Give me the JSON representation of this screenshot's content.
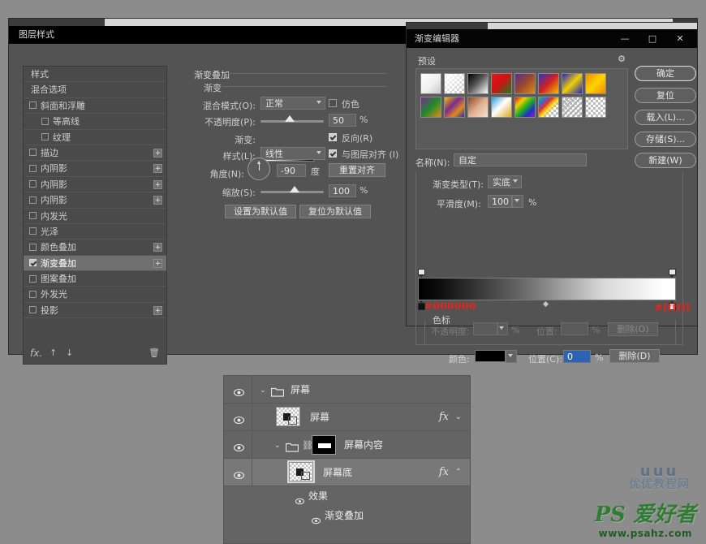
{
  "layer_style_dialog": {
    "title": "图层样式",
    "styles_list": {
      "items": [
        {
          "label": "样式",
          "type": "plain",
          "checkbox": false,
          "checked": false,
          "plus": false,
          "indent": false,
          "selected": false
        },
        {
          "label": "混合选项",
          "type": "plain",
          "checkbox": false,
          "checked": false,
          "plus": false,
          "indent": false,
          "selected": false
        },
        {
          "label": "斜面和浮雕",
          "type": "check",
          "checkbox": true,
          "checked": false,
          "plus": false,
          "indent": false,
          "selected": false
        },
        {
          "label": "等高线",
          "type": "check",
          "checkbox": true,
          "checked": false,
          "plus": false,
          "indent": true,
          "selected": false
        },
        {
          "label": "纹理",
          "type": "check",
          "checkbox": true,
          "checked": false,
          "plus": false,
          "indent": true,
          "selected": false
        },
        {
          "label": "描边",
          "type": "check",
          "checkbox": true,
          "checked": false,
          "plus": true,
          "indent": false,
          "selected": false
        },
        {
          "label": "内阴影",
          "type": "check",
          "checkbox": true,
          "checked": false,
          "plus": true,
          "indent": false,
          "selected": false
        },
        {
          "label": "内阴影",
          "type": "check",
          "checkbox": true,
          "checked": false,
          "plus": true,
          "indent": false,
          "selected": false
        },
        {
          "label": "内阴影",
          "type": "check",
          "checkbox": true,
          "checked": false,
          "plus": true,
          "indent": false,
          "selected": false
        },
        {
          "label": "内发光",
          "type": "check",
          "checkbox": true,
          "checked": false,
          "plus": false,
          "indent": false,
          "selected": false
        },
        {
          "label": "光泽",
          "type": "check",
          "checkbox": true,
          "checked": false,
          "plus": false,
          "indent": false,
          "selected": false
        },
        {
          "label": "颜色叠加",
          "type": "check",
          "checkbox": true,
          "checked": false,
          "plus": true,
          "indent": false,
          "selected": false
        },
        {
          "label": "渐变叠加",
          "type": "check",
          "checkbox": true,
          "checked": true,
          "plus": true,
          "indent": false,
          "selected": true
        },
        {
          "label": "图案叠加",
          "type": "check",
          "checkbox": true,
          "checked": false,
          "plus": false,
          "indent": false,
          "selected": false
        },
        {
          "label": "外发光",
          "type": "check",
          "checkbox": true,
          "checked": false,
          "plus": false,
          "indent": false,
          "selected": false
        },
        {
          "label": "投影",
          "type": "check",
          "checkbox": true,
          "checked": false,
          "plus": true,
          "indent": false,
          "selected": false
        }
      ],
      "footer": {
        "fx": "fx.",
        "move_up": "↑",
        "move_down": "↓",
        "delete": "🗑"
      }
    },
    "gradient_overlay": {
      "section_title": "渐变叠加",
      "sub_title": "渐变",
      "blend_mode_label": "混合模式(O):",
      "blend_mode_value": "正常",
      "dither_label": "仿色",
      "dither_checked": false,
      "opacity_label": "不透明度(P):",
      "opacity_value": "50",
      "opacity_unit": "%",
      "gradient_label": "渐变:",
      "reverse_label": "反向(R)",
      "reverse_checked": true,
      "style_label": "样式(L):",
      "style_value": "线性",
      "align_label": "与图层对齐 (I)",
      "align_checked": true,
      "angle_label": "角度(N):",
      "angle_value": "-90",
      "angle_unit": "度",
      "reset_align_button": "重置对齐",
      "scale_label": "缩放(S):",
      "scale_value": "100",
      "scale_unit": "%",
      "set_default_button": "设置为默认值",
      "reset_default_button": "复位为默认值"
    }
  },
  "gradient_editor_dialog": {
    "title": "渐变编辑器",
    "window_controls": {
      "minimize": "—",
      "maximize": "□",
      "close": "✕"
    },
    "presets_label": "预设",
    "gear_icon": "⚙",
    "buttons": {
      "ok": "确定",
      "reset": "复位",
      "load": "载入(L)...",
      "save": "存储(S)...",
      "new": "新建(W)"
    },
    "name_label": "名称(N):",
    "name_value": "自定",
    "gradient_type_label": "渐变类型(T):",
    "gradient_type_value": "实底",
    "smoothness_label": "平滑度(M):",
    "smoothness_value": "100",
    "smoothness_unit": "%",
    "stops_section_label": "色标",
    "opacity_label": "不透明度:",
    "opacity_value": "",
    "opacity_unit": "%",
    "location_label_top": "位置:",
    "location_value_top": "",
    "location_unit_top": "%",
    "delete_opacity_button": "删除(O)",
    "color_label": "颜色:",
    "color_value_hex": "#000000",
    "location_label": "位置(C):",
    "location_value": "0",
    "location_unit": "%",
    "delete_color_button": "删除(D)",
    "annotation_left": "#000000",
    "annotation_right": "#ffffff",
    "preset_swatches": [
      {
        "name": "foreground-to-background",
        "css": "linear-gradient(135deg,#ffffff 0%,#f0f0f0 55%,#c8c8c8 100%)"
      },
      {
        "name": "foreground-to-transparent",
        "css": "checker-white"
      },
      {
        "name": "black-to-white",
        "css": "linear-gradient(135deg,#000000 0%,#555555 45%,#ffffff 100%)"
      },
      {
        "name": "red-green",
        "css": "linear-gradient(135deg,#e01b1b 0%,#d11010 45%,#1f7a1f 100%)"
      },
      {
        "name": "violet-orange",
        "css": "linear-gradient(135deg,#5a2a8f 0%,#9a4a2a 50%,#e08a1a 100%)"
      },
      {
        "name": "blue-red-yellow",
        "css": "linear-gradient(135deg,#2a35c8 0%,#d02020 50%,#f2c000 100%)"
      },
      {
        "name": "blue-yellow-blue",
        "css": "linear-gradient(135deg,#2020c8 0%,#f0d000 50%,#2020c8 100%)"
      },
      {
        "name": "orange-yellow-orange",
        "css": "linear-gradient(135deg,#f08a00 0%,#ffd400 50%,#f08a00 100%)"
      },
      {
        "name": "violet-green-orange",
        "css": "linear-gradient(135deg,#7a2a8f 0%,#1f8a2a 50%,#e08a1a 100%)"
      },
      {
        "name": "yellow-violet-orange-blue",
        "css": "linear-gradient(135deg,#f0c000 0%,#7a2a8f 40%,#e08a1a 70%,#2030b0 100%)"
      },
      {
        "name": "copper",
        "css": "linear-gradient(135deg,#8a4a28 0%,#e0b090 50%,#f5e0d0 100%)"
      },
      {
        "name": "chrome",
        "css": "linear-gradient(135deg,#2a9ad8 0%,#ffffff 45%,#d8a820 100%)"
      },
      {
        "name": "spectrum",
        "css": "linear-gradient(135deg,#e01010 0%,#f0d000 25%,#20b020 50%,#2030c8 75%,#9020c0 100%)"
      },
      {
        "name": "transparent-rainbow",
        "css": "rainbow-checker"
      },
      {
        "name": "transparent-stripes",
        "css": "stripes-checker"
      },
      {
        "name": "neutral-density",
        "css": "checker-plain"
      }
    ]
  },
  "layers_panel": {
    "rows": [
      {
        "name": "屏幕",
        "kind": "group",
        "expanded": true,
        "visible": true,
        "selected": false,
        "has_fx": false,
        "depth": 0
      },
      {
        "name": "屏幕",
        "kind": "layer",
        "visible": true,
        "selected": false,
        "has_fx": true,
        "fx_chevron": "⌄",
        "depth": 1
      },
      {
        "name": "屏幕内容",
        "kind": "group-masked",
        "expanded": true,
        "visible": true,
        "selected": false,
        "has_fx": false,
        "depth": 1
      },
      {
        "name": "屏幕底",
        "kind": "layer",
        "visible": true,
        "selected": true,
        "has_fx": true,
        "fx_chevron": "⌃",
        "depth": 2
      },
      {
        "name": "效果",
        "kind": "effects",
        "visible": true,
        "depth": 3
      },
      {
        "name": "渐变叠加",
        "kind": "effect-item",
        "visible": true,
        "depth": 4
      }
    ]
  },
  "watermarks": {
    "top": {
      "logo": "uuu",
      "text": "优优教程网"
    },
    "bottom": {
      "brand": "PS 爱好者",
      "url": "www.psahz.com"
    }
  }
}
